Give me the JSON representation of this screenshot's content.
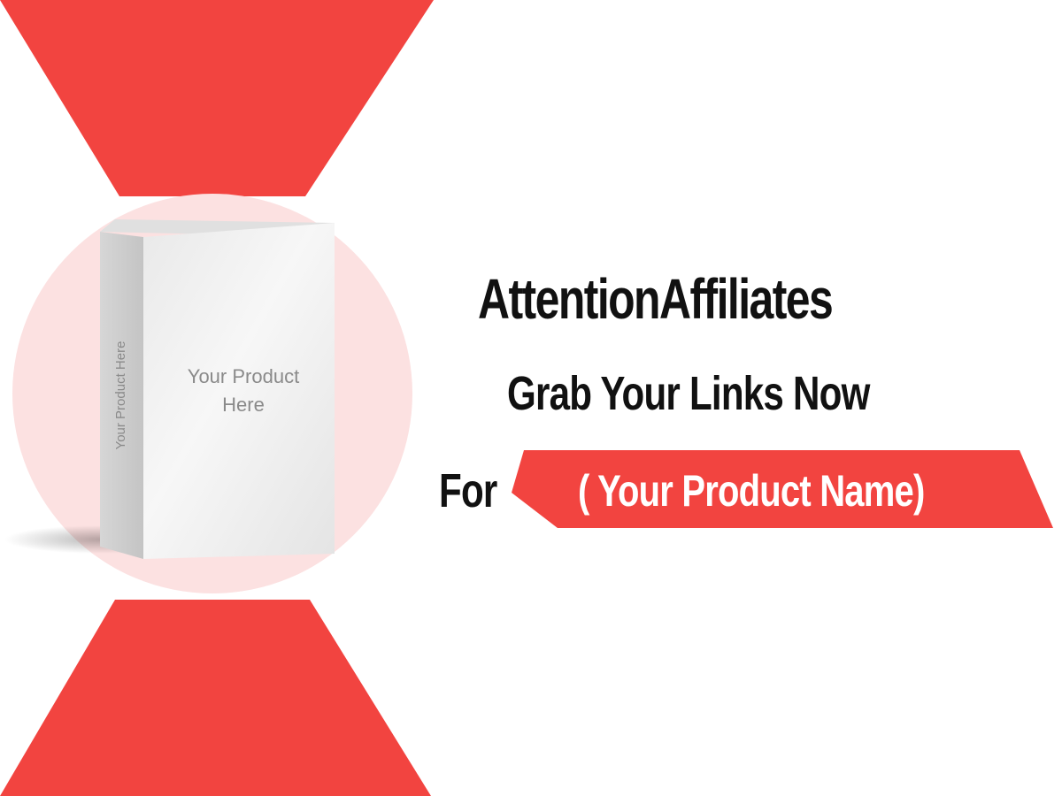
{
  "banner": {
    "brand": "AttentionAffiliates",
    "tagline": "Grab Your Links Now",
    "for_label": "For",
    "product_name": "( Your Product Name)"
  },
  "product_box": {
    "front_label": "Your Product Here",
    "front_label_line1": "Your Product",
    "front_label_line2": "Here",
    "spine_label": "Your Product Here"
  },
  "colors": {
    "accent_red": "#f24440",
    "circle_pink": "#fce1e1",
    "box_white": "#f2f2f2",
    "text_dark": "#111111",
    "text_light": "#ffffff"
  }
}
